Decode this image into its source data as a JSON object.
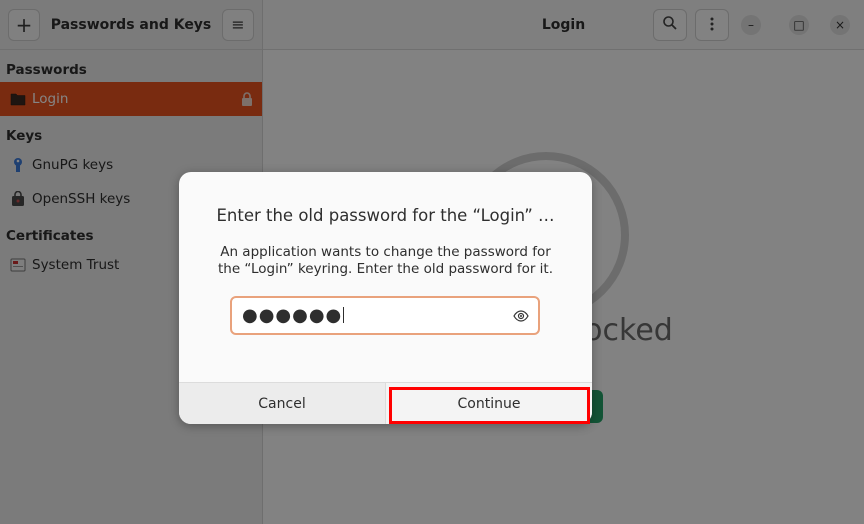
{
  "sidebar": {
    "title": "Passwords and Keys",
    "add_button": "+",
    "menu_button": "≡",
    "sections": [
      {
        "label": "Passwords"
      },
      {
        "label": "Keys"
      },
      {
        "label": "Certificates"
      }
    ],
    "items": [
      {
        "label": "Login",
        "icon": "folder-icon",
        "selected": true,
        "locked": true
      },
      {
        "label": "GnuPG keys",
        "icon": "gnupg-key-icon"
      },
      {
        "label": "OpenSSH keys",
        "icon": "ssh-key-icon"
      },
      {
        "label": "System Trust",
        "icon": "certificate-icon"
      }
    ]
  },
  "main": {
    "title": "Login",
    "window_controls": {
      "minimize": "–",
      "maximize": "□",
      "close": "×"
    },
    "locked_text": "Locked"
  },
  "dialog": {
    "title": "Enter the old password for the “Login” …",
    "message_line1": "An application wants to change the password for",
    "message_line2": "the “Login” keyring. Enter the old password for it.",
    "password_mask": "●●●●●●",
    "cancel_label": "Cancel",
    "continue_label": "Continue"
  },
  "colors": {
    "accent": "#e95420",
    "highlight": "#ff0000",
    "unlock_green": "#26a269"
  }
}
